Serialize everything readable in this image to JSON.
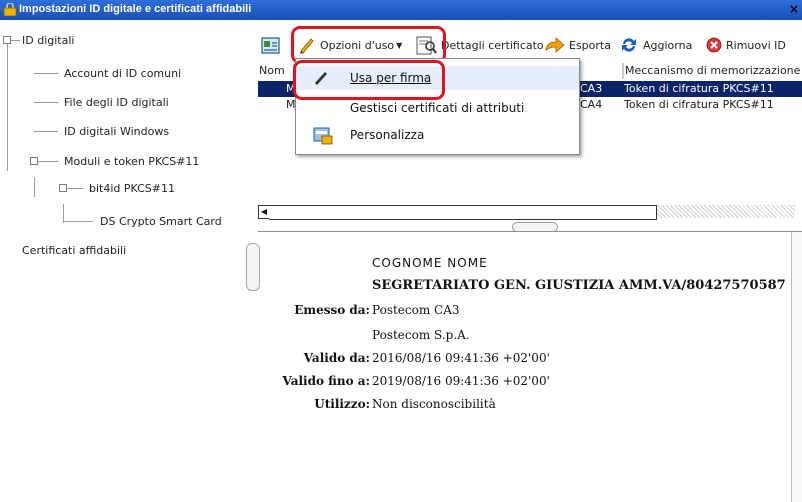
{
  "window": {
    "title": "Impostazioni ID digitale e certificati affidabili",
    "close": "×"
  },
  "tree": {
    "items": [
      {
        "label": "ID digitali"
      },
      {
        "label": "Account di ID comuni"
      },
      {
        "label": "File degli ID digitali"
      },
      {
        "label": "ID digitali Windows"
      },
      {
        "label": "Moduli e token PKCS#11"
      },
      {
        "label": "bit4id PKCS#11"
      },
      {
        "label": "DS Crypto Smart Card"
      },
      {
        "label": "Certificati affidabili"
      }
    ]
  },
  "toolbar": {
    "usage_options": "Opzioni d'uso",
    "certificate_details": "Dettagli certificato",
    "export": "Esporta",
    "refresh": "Aggiorna",
    "remove_id": "Rimuovi ID"
  },
  "list": {
    "columns": [
      "Nom",
      "",
      "",
      "Meccanismo di memorizzazione"
    ],
    "rows": [
      {
        "name": "M",
        "issuer_tail": "CA3",
        "storage": "Token di cifratura PKCS#11",
        "selected": true
      },
      {
        "name": "MI",
        "issuer_tail": "CA4",
        "storage": "Token di cifratura PKCS#11",
        "selected": false
      }
    ]
  },
  "menu": {
    "items": [
      {
        "label": "Usa per firma",
        "mnemonic": "U"
      },
      {
        "label": "Gestisci certificati di attributi",
        "mnemonic": "G"
      },
      {
        "label": "Personalizza",
        "mnemonic": "P"
      }
    ]
  },
  "detail": {
    "name": "COGNOME NOME",
    "organization": "SEGRETARIATO GEN. GIUSTIZIA AMM.VA/80427570587",
    "issued_by_label": "Emesso da:",
    "issued_by": "Postecom CA3",
    "issuer_company": "Postecom S.p.A.",
    "valid_from_label": "Valido da:",
    "valid_from": "2016/08/16 09:41:36 +02'00'",
    "valid_to_label": "Valido fino a:",
    "valid_to": "2019/08/16 09:41:36 +02'00'",
    "usage_label": "Utilizzo:",
    "usage": "Non disconoscibilità"
  },
  "colors": {
    "highlight": "#e0141e",
    "selection": "#0a246a",
    "titlebar": "#1b4fb7"
  }
}
